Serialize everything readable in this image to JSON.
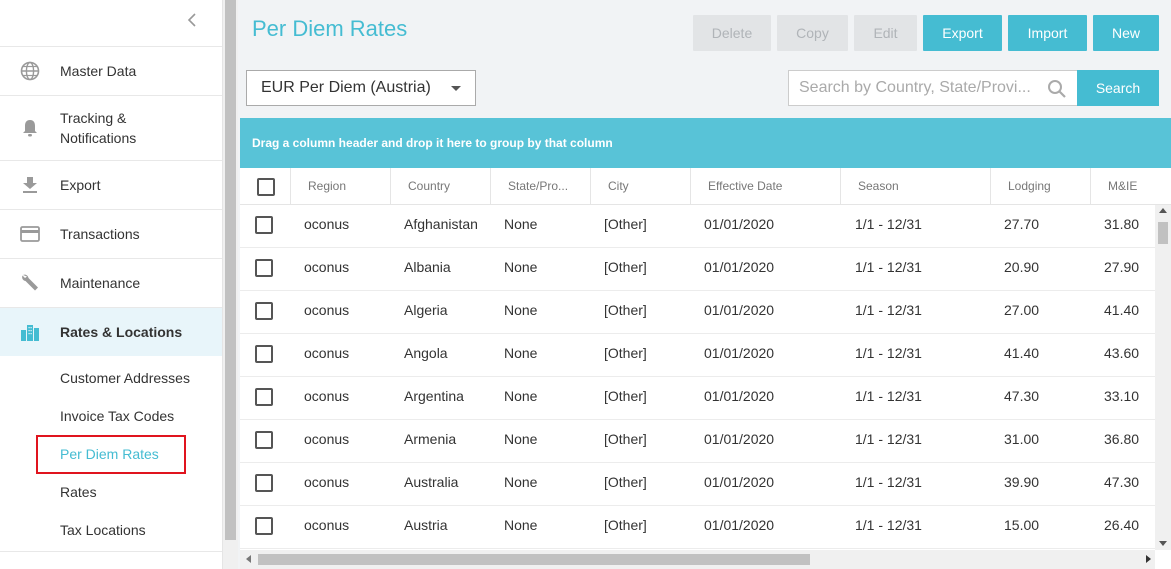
{
  "sidebar": {
    "collapse_icon": "chevron-left-icon",
    "items": [
      {
        "label": "Master Data",
        "icon": "globe-icon"
      },
      {
        "label": "Tracking &\nNotifications",
        "icon": "bell-icon"
      },
      {
        "label": "Export",
        "icon": "download-icon"
      },
      {
        "label": "Transactions",
        "icon": "credit-card-icon"
      },
      {
        "label": "Maintenance",
        "icon": "wrench-icon"
      },
      {
        "label": "Rates & Locations",
        "icon": "city-icon",
        "active": true
      }
    ],
    "sub_items": [
      {
        "label": "Customer Addresses"
      },
      {
        "label": "Invoice Tax Codes"
      },
      {
        "label": "Per Diem Rates",
        "active": true
      },
      {
        "label": "Rates"
      },
      {
        "label": "Tax Locations"
      }
    ]
  },
  "page": {
    "title": "Per Diem Rates"
  },
  "toolbar": {
    "delete_label": "Delete",
    "copy_label": "Copy",
    "edit_label": "Edit",
    "export_label": "Export",
    "import_label": "Import",
    "new_label": "New"
  },
  "filter": {
    "selected": "EUR Per Diem (Austria)"
  },
  "search": {
    "placeholder": "Search by Country, State/Provi...",
    "value": "",
    "button_label": "Search"
  },
  "grid": {
    "group_hint": "Drag a column header and drop it here to group by that column",
    "columns": [
      "Region",
      "Country",
      "State/Pro...",
      "City",
      "Effective Date",
      "Season",
      "Lodging",
      "M&IE"
    ],
    "rows": [
      [
        "oconus",
        "Afghanistan",
        "None",
        "[Other]",
        "01/01/2020",
        "1/1 - 12/31",
        "27.70",
        "31.80"
      ],
      [
        "oconus",
        "Albania",
        "None",
        "[Other]",
        "01/01/2020",
        "1/1 - 12/31",
        "20.90",
        "27.90"
      ],
      [
        "oconus",
        "Algeria",
        "None",
        "[Other]",
        "01/01/2020",
        "1/1 - 12/31",
        "27.00",
        "41.40"
      ],
      [
        "oconus",
        "Angola",
        "None",
        "[Other]",
        "01/01/2020",
        "1/1 - 12/31",
        "41.40",
        "43.60"
      ],
      [
        "oconus",
        "Argentina",
        "None",
        "[Other]",
        "01/01/2020",
        "1/1 - 12/31",
        "47.30",
        "33.10"
      ],
      [
        "oconus",
        "Armenia",
        "None",
        "[Other]",
        "01/01/2020",
        "1/1 - 12/31",
        "31.00",
        "36.80"
      ],
      [
        "oconus",
        "Australia",
        "None",
        "[Other]",
        "01/01/2020",
        "1/1 - 12/31",
        "39.90",
        "47.30"
      ],
      [
        "oconus",
        "Austria",
        "None",
        "[Other]",
        "01/01/2020",
        "1/1 - 12/31",
        "15.00",
        "26.40"
      ]
    ]
  },
  "colors": {
    "accent": "#45bcd2",
    "group_bar": "#58c3d7",
    "highlight": "#e0141e"
  }
}
